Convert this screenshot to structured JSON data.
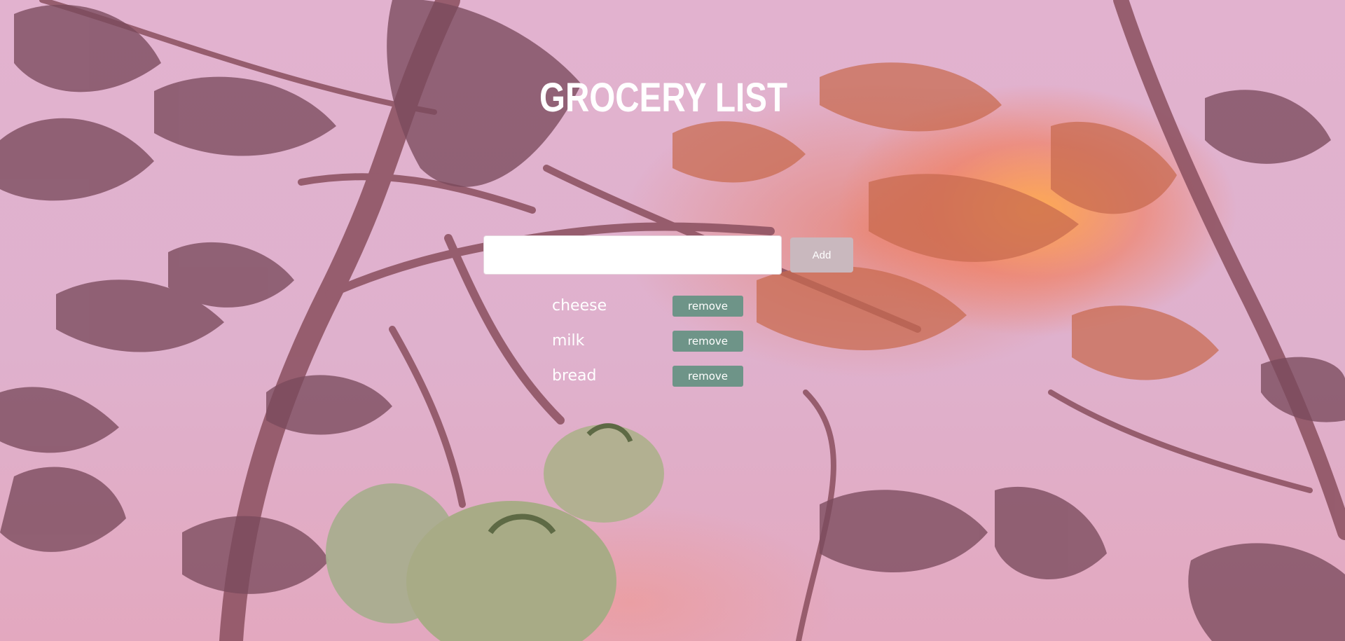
{
  "header": {
    "title": "GROCERY LIST"
  },
  "add_form": {
    "input_value": "",
    "input_placeholder": "",
    "add_label": "Add"
  },
  "items": [
    {
      "label": "cheese",
      "remove_label": "remove"
    },
    {
      "label": "milk",
      "remove_label": "remove"
    },
    {
      "label": "bread",
      "remove_label": "remove"
    }
  ],
  "colors": {
    "overlay_pink": "#dfb1cd",
    "add_button": "#c9b8be",
    "remove_button": "#6e9488",
    "text": "#ffffff"
  },
  "background": {
    "icon": "tomato-plant-sunset-photo"
  }
}
